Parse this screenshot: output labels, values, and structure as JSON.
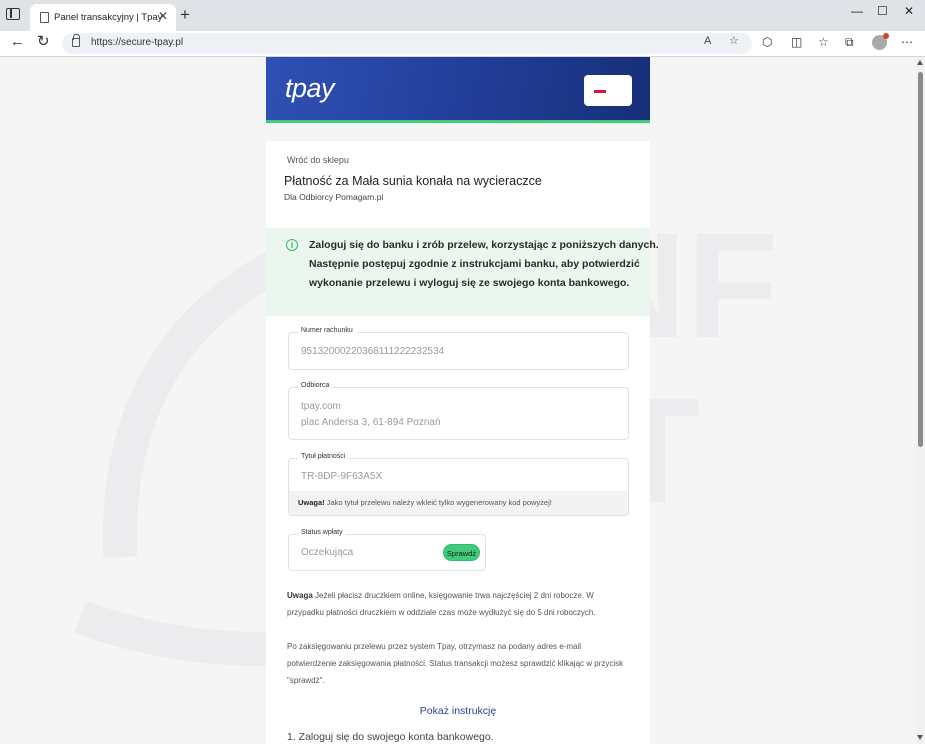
{
  "browser": {
    "tab_title": "Panel transakcyjny | Tpay",
    "tab_close": "✕",
    "new_tab": "+",
    "url": "https://secure-tpay.pl",
    "window_controls": {
      "minimize": "—",
      "maximize": "☐",
      "close": "✕"
    }
  },
  "header": {
    "logo": "tpay",
    "flag_colors": [
      "#ffffff",
      "#dc143c"
    ]
  },
  "card": {
    "back_link": "Wróć do sklepu",
    "title": "Płatność za Mała sunia konała na wycieraczce",
    "recipient": "Dla Odbiorcy Pomagam.pl",
    "info": {
      "line1": "Zaloguj się do banku i zrób przelew, korzystając z poniższych danych.",
      "line2": "Następnie postępuj zgodnie z instrukcjami banku, aby potwierdzić",
      "line3": "wykonanie przelewu i wyloguj się ze swojego konta bankowego."
    },
    "fields": {
      "account": {
        "label": "Numer rachunku",
        "value": "95132000220368111222232534"
      },
      "receiver": {
        "label": "Odbiorca",
        "line1": "tpay.com",
        "line2": "plac Andersa 3, 61-894 Poznań"
      },
      "title": {
        "label": "Tytuł płatności",
        "value": "TR-8DP-9F63A5X",
        "note_bold": "Uwaga!",
        "note": " Jako tytuł przelewu należy wkleić tylko wygenerowany kod powyżej!"
      },
      "status": {
        "label": "Status wpłaty",
        "value": "Oczekująca",
        "button": "Sprawdź"
      }
    },
    "notice_bold": "Uwaga",
    "notice": " Jeżeli płacisz druczkiem online, księgowanie trwa najczęściej 2 dni robocze. W przypadku płatności druczkiem w oddziale czas może wydłużyć się do 5 dni roboczych.",
    "confirmation": "Po zaksięgowaniu przelewu przez system Tpay, otrzymasz na podany adres e-mail potwierdzenie zaksięgowania płatności. Status transakcji możesz sprawdzić klikając w przycisk \"sprawdź\".",
    "show_instructions": "Pokaż instrukcję",
    "step1": "1. Zaloguj się do swojego konta bankowego."
  },
  "colors": {
    "accent_green": "#3fcb7c",
    "header_blue": "#223d98",
    "link_blue": "#2d3f8c"
  }
}
